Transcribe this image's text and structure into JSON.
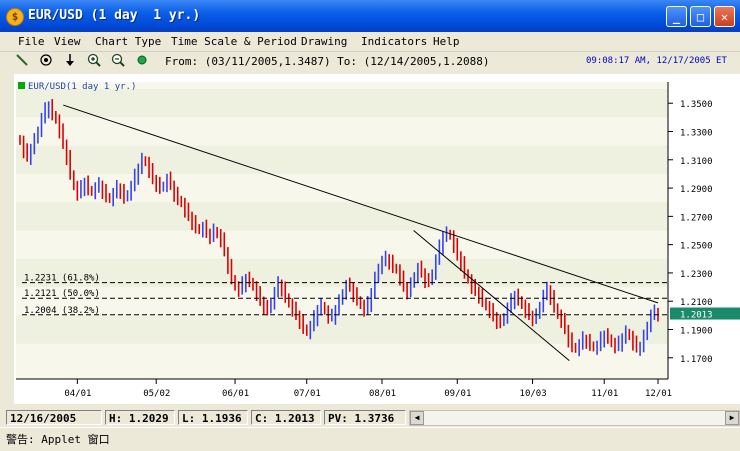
{
  "window": {
    "title": "EUR/USD (1 day  1 yr.)",
    "app_icon": "coin-icon"
  },
  "menu": [
    "File",
    "View",
    "Chart Type",
    "Time Scale & Period",
    "Drawing",
    "Indicators",
    "Help"
  ],
  "toolbar": {
    "tools": [
      "line-tool-icon",
      "crosshair-icon",
      "down-arrow-icon",
      "zoom-in-icon",
      "zoom-out-icon",
      "green-dot-icon"
    ],
    "from_to": "From: (03/11/2005,1.3487) To: (12/14/2005,1.2088)",
    "clock": "09:08:17 AM, 12/17/2005 ET"
  },
  "chart": {
    "legend": "EUR/USD(1 day  1 yr.)",
    "legend_color": "#00aa00"
  },
  "chart_data": {
    "type": "candlestick",
    "symbol": "EUR/USD",
    "ylim": [
      1.155,
      1.365
    ],
    "y_ticks": [
      1.35,
      1.33,
      1.31,
      1.29,
      1.27,
      1.25,
      1.23,
      1.21,
      1.19,
      1.17
    ],
    "y_tick_labels": [
      "1.3500",
      "1.3300",
      "1.3100",
      "1.2900",
      "1.2700",
      "1.2500",
      "1.2300",
      "1.2100",
      "1.1900",
      "1.1700"
    ],
    "x_ticks": [
      "04/01",
      "05/02",
      "06/01",
      "07/01",
      "08/01",
      "09/01",
      "10/03",
      "11/01",
      "12/01"
    ],
    "last_price": "1.2013",
    "up_color": "#3344ee",
    "down_color": "#dd0000",
    "fib_levels": [
      {
        "label": "1.2231 (61.8%)",
        "value": 1.2231
      },
      {
        "label": "1.2121 (50.0%)",
        "value": 1.2121
      },
      {
        "label": "1.2004 (38.2%)",
        "value": 1.2004
      }
    ],
    "trendlines": [
      {
        "from": {
          "day": 20,
          "price": 1.3487
        },
        "to": {
          "day": 295,
          "price": 1.2088
        }
      },
      {
        "from": {
          "day": 182,
          "price": 1.26
        },
        "to": {
          "day": 254,
          "price": 1.168
        }
      }
    ],
    "closes": [
      1.323,
      1.316,
      1.312,
      1.318,
      1.324,
      1.331,
      1.339,
      1.345,
      1.348,
      1.342,
      1.338,
      1.33,
      1.321,
      1.312,
      1.3,
      1.291,
      1.286,
      1.29,
      1.294,
      1.289,
      1.287,
      1.29,
      1.292,
      1.288,
      1.284,
      1.282,
      1.286,
      1.29,
      1.288,
      1.283,
      1.286,
      1.291,
      1.298,
      1.304,
      1.31,
      1.308,
      1.302,
      1.296,
      1.293,
      1.29,
      1.292,
      1.296,
      1.292,
      1.286,
      1.282,
      1.279,
      1.274,
      1.27,
      1.266,
      1.262,
      1.26,
      1.262,
      1.258,
      1.256,
      1.26,
      1.257,
      1.253,
      1.245,
      1.235,
      1.226,
      1.22,
      1.218,
      1.222,
      1.226,
      1.224,
      1.22,
      1.215,
      1.21,
      1.206,
      1.204,
      1.209,
      1.216,
      1.222,
      1.219,
      1.213,
      1.208,
      1.204,
      1.2,
      1.196,
      1.191,
      1.188,
      1.192,
      1.198,
      1.204,
      1.207,
      1.203,
      1.199,
      1.199,
      1.204,
      1.21,
      1.216,
      1.221,
      1.22,
      1.215,
      1.211,
      1.207,
      1.204,
      1.208,
      1.216,
      1.226,
      1.234,
      1.238,
      1.24,
      1.238,
      1.234,
      1.232,
      1.226,
      1.22,
      1.217,
      1.222,
      1.228,
      1.233,
      1.23,
      1.225,
      1.224,
      1.23,
      1.239,
      1.248,
      1.256,
      1.258,
      1.256,
      1.249,
      1.242,
      1.237,
      1.23,
      1.225,
      1.22,
      1.217,
      1.214,
      1.21,
      1.206,
      1.203,
      1.199,
      1.196,
      1.195,
      1.199,
      1.205,
      1.21,
      1.214,
      1.211,
      1.207,
      1.203,
      1.2,
      1.198,
      1.2,
      1.207,
      1.214,
      1.218,
      1.213,
      1.206,
      1.2,
      1.196,
      1.19,
      1.183,
      1.178,
      1.176,
      1.179,
      1.183,
      1.182,
      1.179,
      1.177,
      1.178,
      1.183,
      1.186,
      1.184,
      1.18,
      1.178,
      1.18,
      1.184,
      1.188,
      1.185,
      1.18,
      1.177,
      1.178,
      1.185,
      1.193,
      1.2,
      1.202,
      1.2013
    ],
    "closes_note": "approximate daily closes read from the chart"
  },
  "status": {
    "date": "12/16/2005",
    "high": "H: 1.2029",
    "low": "L: 1.1936",
    "close": "C: 1.2013",
    "pv": "PV: 1.3736"
  },
  "warning": "警告: Applet 窗口"
}
